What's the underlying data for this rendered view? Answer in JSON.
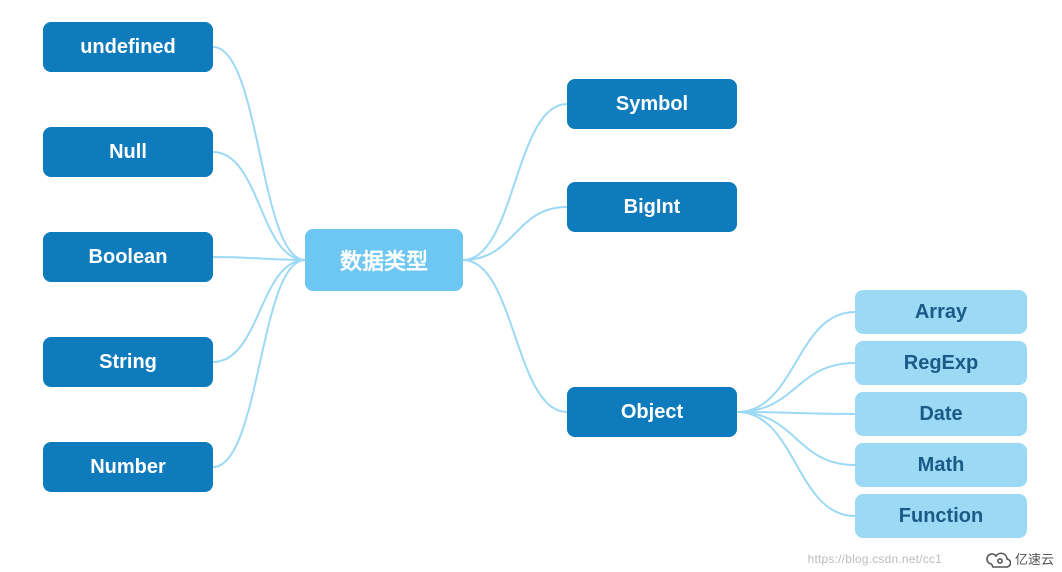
{
  "center": {
    "label": "数据类型"
  },
  "left_nodes": [
    {
      "id": "undefined",
      "label": "undefined"
    },
    {
      "id": "null",
      "label": "Null"
    },
    {
      "id": "boolean",
      "label": "Boolean"
    },
    {
      "id": "string",
      "label": "String"
    },
    {
      "id": "number",
      "label": "Number"
    }
  ],
  "right_nodes": [
    {
      "id": "symbol",
      "label": "Symbol"
    },
    {
      "id": "bigint",
      "label": "BigInt"
    },
    {
      "id": "object",
      "label": "Object"
    }
  ],
  "object_children": [
    {
      "id": "array",
      "label": "Array"
    },
    {
      "id": "regexp",
      "label": "RegExp"
    },
    {
      "id": "date",
      "label": "Date"
    },
    {
      "id": "math",
      "label": "Math"
    },
    {
      "id": "function",
      "label": "Function"
    }
  ],
  "watermark": "https://blog.csdn.net/cc1",
  "brand": "亿速云",
  "colors": {
    "dark": "#0e7bbd",
    "center": "#6dc7f2",
    "light": "#9cd9f4",
    "edge": "#9cd9f4"
  }
}
